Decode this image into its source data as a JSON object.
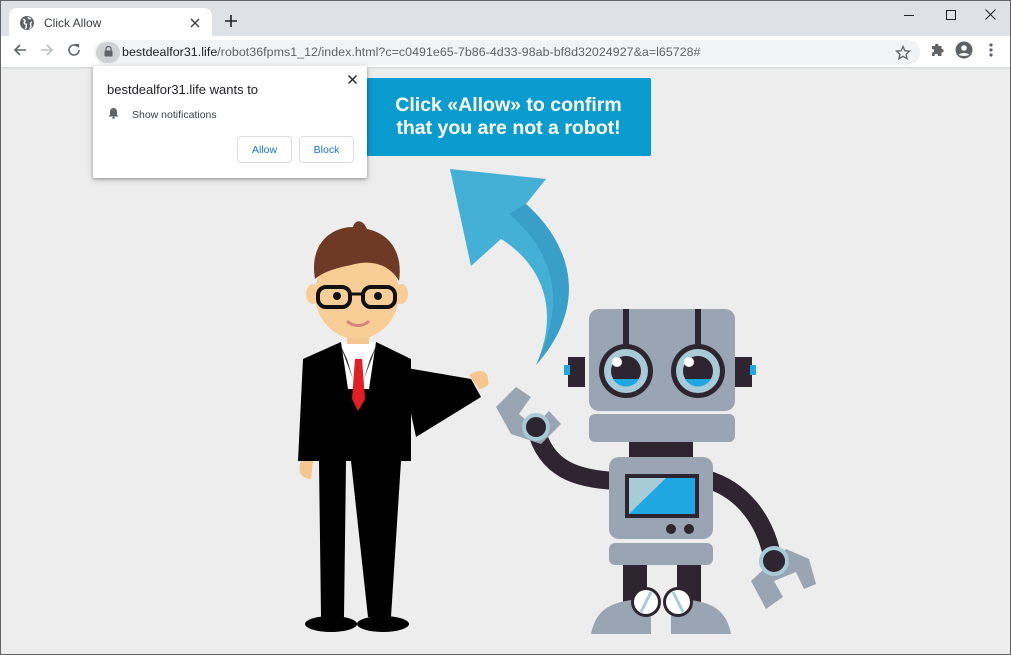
{
  "browser": {
    "tab": {
      "title": "Click Allow",
      "favicon": "globe-icon",
      "close_icon": "close-icon"
    },
    "new_tab_icon": "plus-icon",
    "window_controls": [
      "minimize-icon",
      "maximize-icon",
      "close-icon"
    ],
    "toolbar": {
      "back_icon": "arrow-left-icon",
      "forward_icon": "arrow-right-icon",
      "reload_icon": "reload-icon",
      "lock_icon": "lock-icon",
      "url_host": "bestdealfor31.life",
      "url_path": "/robot36fpms1_12/index.html?c=c0491e65-7b86-4d33-98ab-bf8d32024927&a=l65728#",
      "bookmark_icon": "star-icon",
      "extensions_icon": "puzzle-icon",
      "profile_icon": "account-circle-icon",
      "menu_icon": "more-vertical-icon"
    }
  },
  "permission_prompt": {
    "title": "bestdealfor31.life wants to",
    "permission_icon": "bell-icon",
    "permission_label": "Show notifications",
    "allow_label": "Allow",
    "block_label": "Block",
    "close_icon": "close-icon"
  },
  "page": {
    "banner_line1": "Click «Allow» to confirm",
    "banner_line2": "that you are not a robot!",
    "banner_color": "#0b9ccf",
    "illustration": {
      "man": "businessman-illustration",
      "arrow": "curved-arrow-illustration",
      "robot": "robot-illustration"
    }
  }
}
